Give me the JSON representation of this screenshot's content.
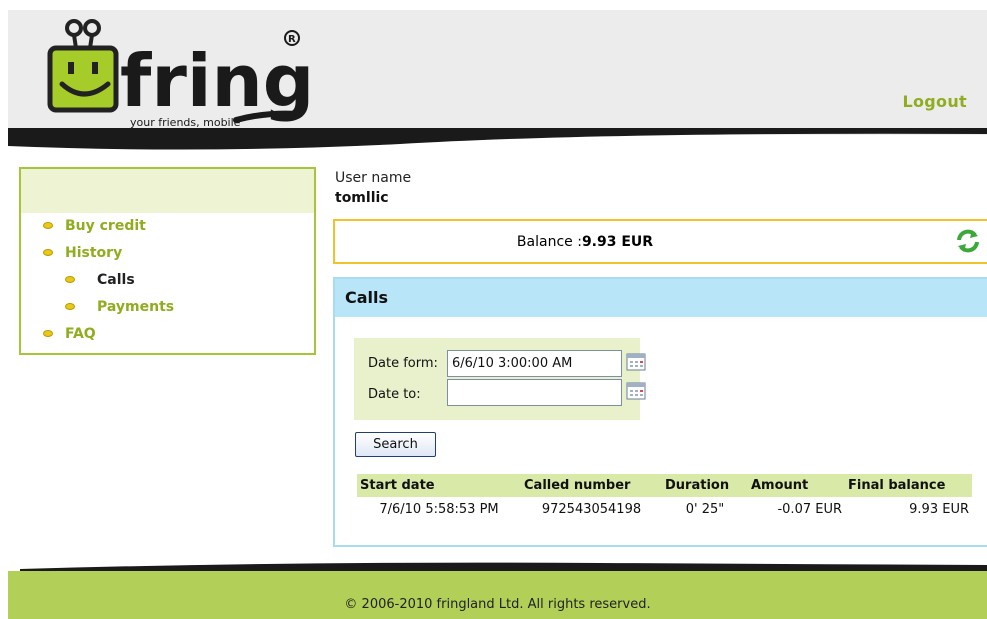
{
  "header": {
    "logo_text": "fring",
    "logo_tagline": "your friends, mobile",
    "logout_label": "Logout"
  },
  "sidebar": {
    "items": [
      {
        "label": "Buy credit",
        "level": 1
      },
      {
        "label": "History",
        "level": 1
      },
      {
        "label": "Calls",
        "level": 2,
        "active": true
      },
      {
        "label": "Payments",
        "level": 2
      },
      {
        "label": "FAQ",
        "level": 1
      }
    ]
  },
  "user": {
    "label": "User name",
    "name": "tomllic"
  },
  "balance": {
    "label": "Balance :",
    "value": "9.93 EUR"
  },
  "calls": {
    "title": "Calls",
    "date_from_label": "Date form:",
    "date_from_value": "6/6/10 3:00:00 AM",
    "date_to_label": "Date to:",
    "date_to_value": "",
    "search_label": "Search",
    "columns": [
      "Start date",
      "Called number",
      "Duration",
      "Amount",
      "Final balance"
    ],
    "rows": [
      [
        "7/6/10 5:58:53 PM",
        "972543054198",
        "0' 25\"",
        "-0.07 EUR",
        "9.93 EUR"
      ]
    ]
  },
  "footer": {
    "copyright": "© 2006-2010 fringland Ltd. All rights reserved."
  },
  "colors": {
    "brand_green": "#8fad1f",
    "sidebar_border": "#a6c63a",
    "balance_border": "#f0c22c",
    "calls_header": "#b8e5f7",
    "footer_green": "#b2d057"
  }
}
